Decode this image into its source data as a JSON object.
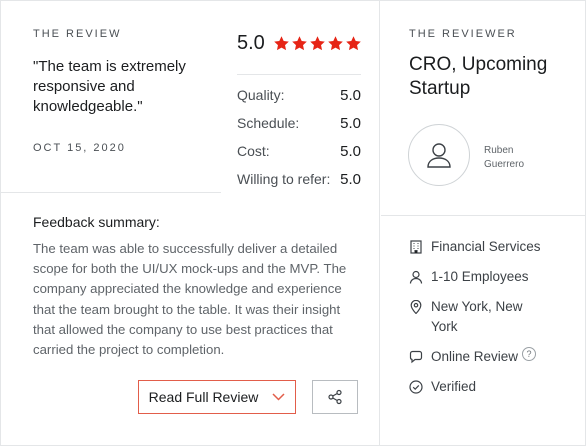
{
  "review": {
    "eyebrow": "THE REVIEW",
    "quote": "\"The team is extremely responsive and knowledgeable.\"",
    "date": "OCT 15, 2020",
    "overall_score": "5.0",
    "stars_count": 5,
    "ratings": [
      {
        "label": "Quality:",
        "value": "5.0"
      },
      {
        "label": "Schedule:",
        "value": "5.0"
      },
      {
        "label": "Cost:",
        "value": "5.0"
      },
      {
        "label": "Willing to refer:",
        "value": "5.0"
      }
    ],
    "feedback_title": "Feedback summary:",
    "feedback_body": "The team was able to successfully deliver a detailed scope for both the UI/UX mock-ups and the MVP. The company appreciated the knowledge and experience that the team brought to the table. It was their insight that allowed the company to use best practices that carried the project to completion.",
    "read_full_label": "Read Full Review"
  },
  "reviewer": {
    "eyebrow": "THE REVIEWER",
    "title": "CRO, Upcoming Startup",
    "name": "Ruben Guerrero",
    "industry": "Financial Services",
    "size": "1-10 Employees",
    "location": "New York, New York",
    "review_type": "Online Review",
    "help_glyph": "?",
    "status": "Verified"
  },
  "colors": {
    "star": "#e62415",
    "button_border": "#e25d4a",
    "divider": "#e4e6e8"
  },
  "icons": {
    "stars": "star-icon",
    "chevron": "chevron-down-icon",
    "share": "share-icon",
    "avatar": "user-icon",
    "industry": "building-icon",
    "size": "person-icon",
    "location": "map-pin-icon",
    "review_type": "chat-bubble-icon",
    "status": "check-circle-icon"
  }
}
